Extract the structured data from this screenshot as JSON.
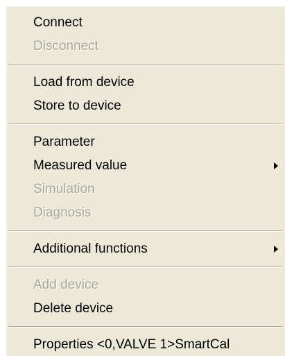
{
  "menu": {
    "group1": [
      {
        "label": "Connect",
        "enabled": true
      },
      {
        "label": "Disconnect",
        "enabled": false
      }
    ],
    "group2": [
      {
        "label": "Load from device",
        "enabled": true
      },
      {
        "label": "Store to device",
        "enabled": true
      }
    ],
    "group3": [
      {
        "label": "Parameter",
        "enabled": true
      },
      {
        "label": "Measured value",
        "enabled": true,
        "submenu": true
      },
      {
        "label": "Simulation",
        "enabled": false
      },
      {
        "label": "Diagnosis",
        "enabled": false
      }
    ],
    "group4": [
      {
        "label": "Additional functions",
        "enabled": true,
        "submenu": true
      }
    ],
    "group5": [
      {
        "label": "Add device",
        "enabled": false
      },
      {
        "label": "Delete device",
        "enabled": true
      }
    ],
    "group6": [
      {
        "label": "Properties <0,VALVE 1>SmartCal",
        "enabled": true
      }
    ]
  },
  "colors": {
    "menu_bg": "#ece9d8",
    "disabled_text": "#a9a69a",
    "separator": "#aca899"
  }
}
